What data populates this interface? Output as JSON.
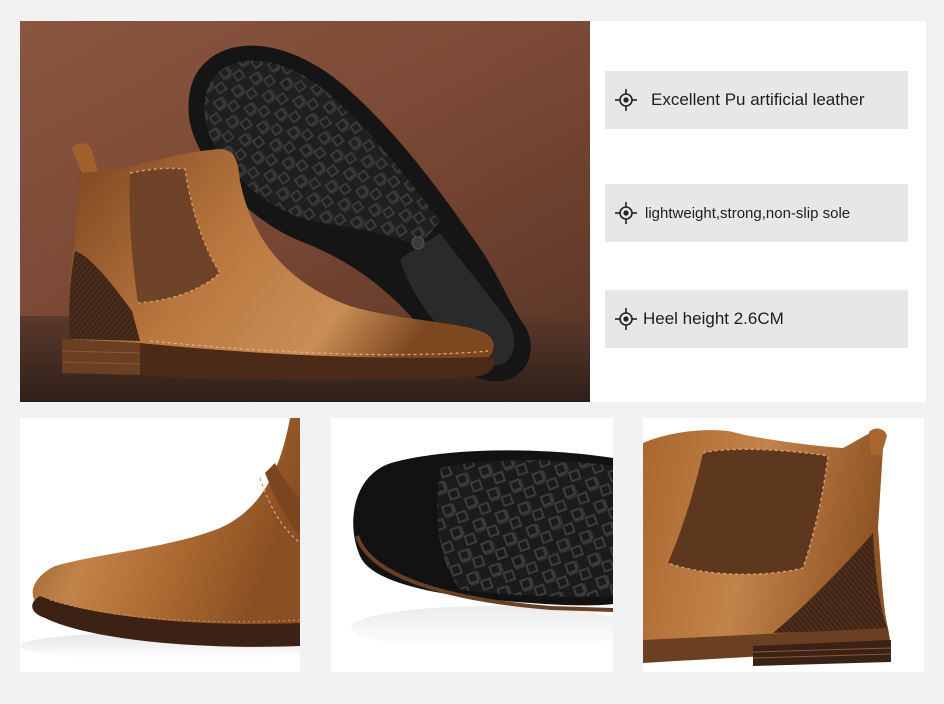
{
  "features": [
    {
      "label": "Excellent Pu artificial leather",
      "icon": "crosshair-icon"
    },
    {
      "label": "lightweight,strong,non-slip sole",
      "icon": "crosshair-icon"
    },
    {
      "label": "Heel height 2.6CM",
      "icon": "crosshair-icon"
    }
  ],
  "colors": {
    "leather": "#a0612e",
    "leather_dark": "#6b3a17",
    "sole": "#1c1c1c",
    "wall": "#7a4a33",
    "feature_bg": "#e7e7e7"
  }
}
